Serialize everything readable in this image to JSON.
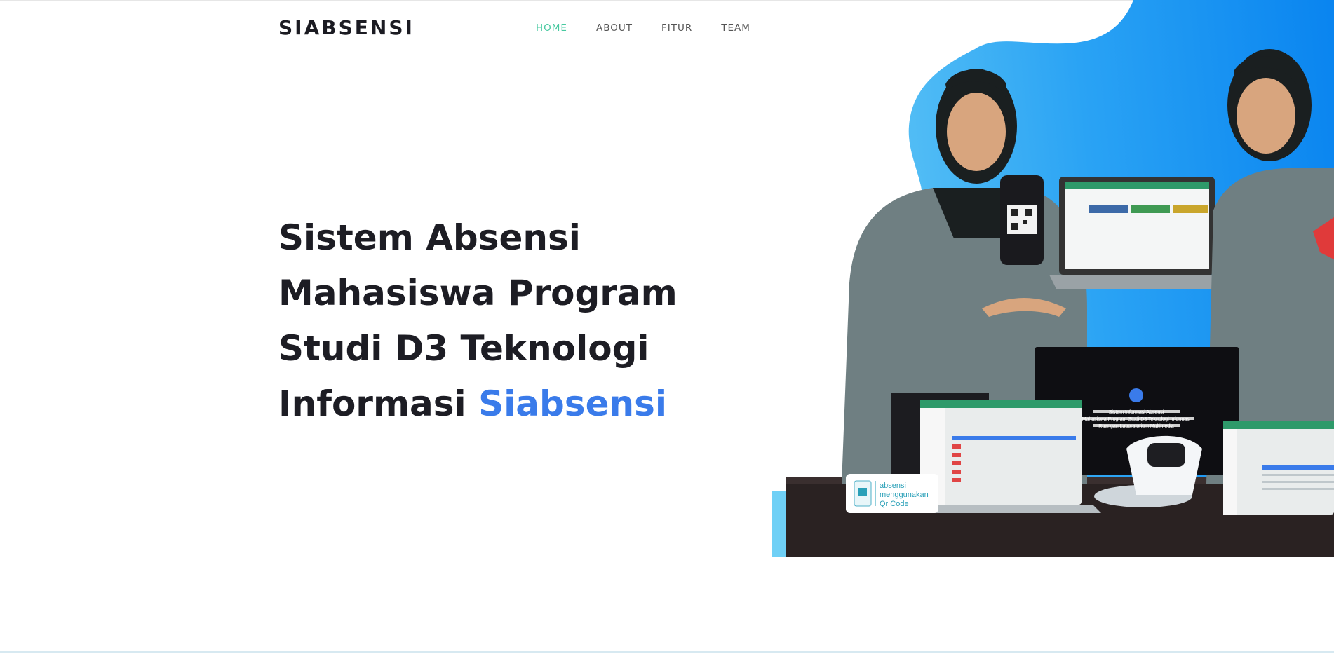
{
  "header": {
    "brand": "SIABSENSI",
    "nav": [
      "HOME",
      "ABOUT",
      "FITUR",
      "TEAM"
    ],
    "active_nav": "HOME"
  },
  "hero": {
    "title_lines": [
      "Sistem Absensi",
      "Mahasiswa Program",
      "Studi D3 Teknologi",
      "Informasi"
    ],
    "title_accent": "Siabsensi"
  },
  "illustration": {
    "badge_text": [
      "absensi",
      "menggunakan",
      "Qr Code"
    ],
    "screen_text": [
      "Sistem Informasi Absensi",
      "Mahasiswa Program Studi D3 Teknologi Informasi",
      "Ruangan Laboratorium Multimedia"
    ]
  },
  "colors": {
    "accent_nav": "#47c9a0",
    "accent_title": "#3a7bea",
    "blob_light": "#6fd0f6",
    "blob_dark": "#0a85f0"
  }
}
